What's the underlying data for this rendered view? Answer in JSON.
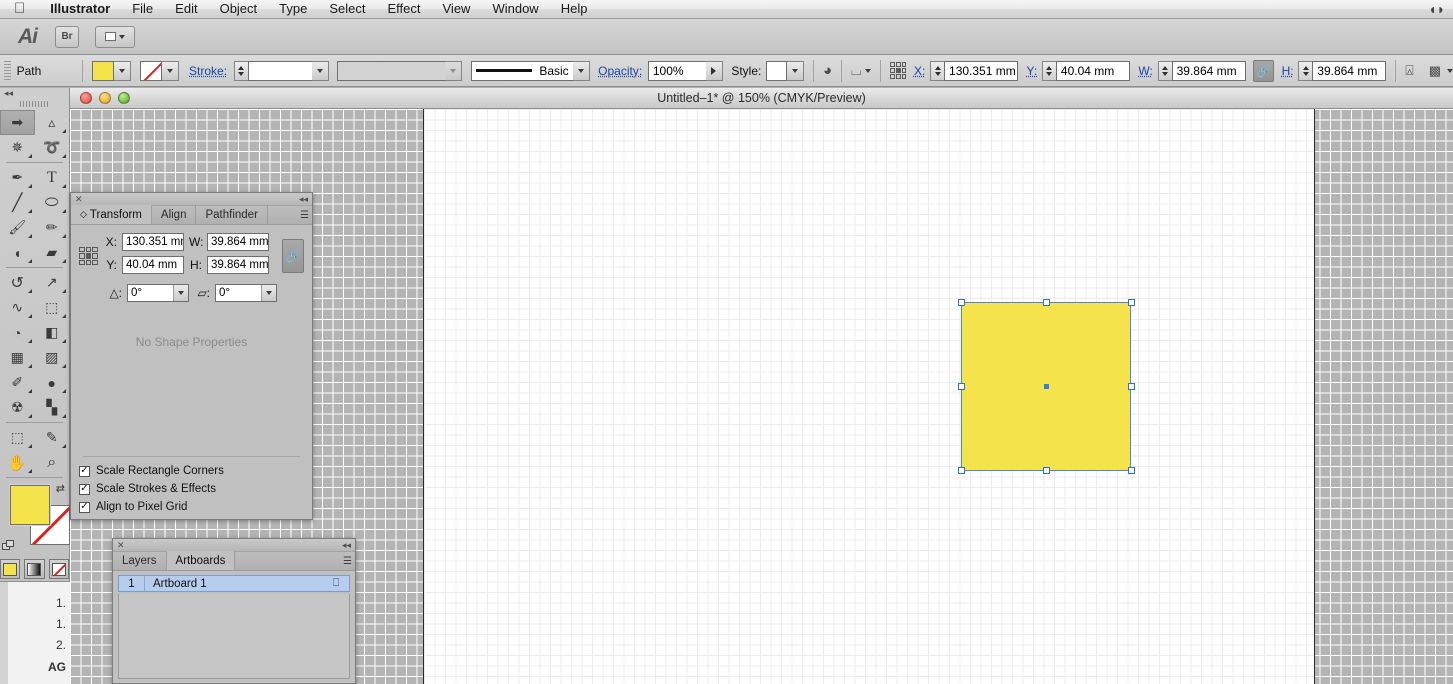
{
  "menubar": {
    "apple": "apple-logo",
    "items": [
      "Illustrator",
      "File",
      "Edit",
      "Object",
      "Type",
      "Select",
      "Effect",
      "View",
      "Window",
      "Help"
    ],
    "right_icon": "spectacles-icon"
  },
  "appbar": {
    "logo": "Ai",
    "bridge_label": "Br",
    "arrange_label": "arrange-documents"
  },
  "controlbar": {
    "selection_label": "Path",
    "fill_color": "#f4e34a",
    "stroke_label": "Stroke:",
    "stroke_weight": "",
    "stroke_profile": "",
    "brush_label": "Basic",
    "opacity_label": "Opacity:",
    "opacity_value": "100%",
    "style_label": "Style:",
    "x_label": "X:",
    "x_value": "130.351 mm",
    "y_label": "Y:",
    "y_value": "40.04 mm",
    "w_label": "W:",
    "w_value": "39.864 mm",
    "h_label": "H:",
    "h_value": "39.864 mm",
    "link_icon": "link-chain-icon",
    "recolor_icon": "recolor-artwork-icon",
    "isolate_icon": "isolate-selection-icon",
    "transform_proxy_icon": "transform-reference-point-icon",
    "align_icon": "align-objects-icon",
    "select_similar_icon": "select-similar-objects-icon"
  },
  "document": {
    "title": "Untitled–1* @ 150% (CMYK/Preview)",
    "zoom": "150%",
    "color_mode": "CMYK/Preview"
  },
  "tools": {
    "items": [
      {
        "name": "selection-tool",
        "glyph": "⬉",
        "selected": true
      },
      {
        "name": "direct-selection-tool",
        "glyph": "⬈",
        "selected": false
      },
      {
        "name": "magic-wand-tool",
        "glyph": "✳",
        "selected": false
      },
      {
        "name": "lasso-tool",
        "glyph": "➰",
        "selected": false
      },
      {
        "name": "pen-tool",
        "glyph": "✒",
        "selected": false
      },
      {
        "name": "type-tool",
        "glyph": "T",
        "selected": false
      },
      {
        "name": "line-segment-tool",
        "glyph": "╱",
        "selected": false
      },
      {
        "name": "ellipse-tool",
        "glyph": "⬭",
        "selected": false
      },
      {
        "name": "paintbrush-tool",
        "glyph": "✎",
        "selected": false
      },
      {
        "name": "pencil-tool",
        "glyph": "✏",
        "selected": false
      },
      {
        "name": "blob-brush-tool",
        "glyph": "◖",
        "selected": false
      },
      {
        "name": "eraser-tool",
        "glyph": "▰",
        "selected": false
      },
      {
        "name": "rotate-tool",
        "glyph": "↺",
        "selected": false
      },
      {
        "name": "scale-tool",
        "glyph": "↗",
        "selected": false
      },
      {
        "name": "width-tool",
        "glyph": "∿",
        "selected": false
      },
      {
        "name": "free-transform-tool",
        "glyph": "⬚",
        "selected": false
      },
      {
        "name": "shape-builder-tool",
        "glyph": "◔",
        "selected": false
      },
      {
        "name": "perspective-grid-tool",
        "glyph": "◧",
        "selected": false
      },
      {
        "name": "mesh-tool",
        "glyph": "✦",
        "selected": false
      },
      {
        "name": "gradient-tool",
        "glyph": "▨",
        "selected": false
      },
      {
        "name": "eyedropper-tool",
        "glyph": "✐",
        "selected": false
      },
      {
        "name": "blend-tool",
        "glyph": "●",
        "selected": false
      },
      {
        "name": "symbol-sprayer-tool",
        "glyph": "☃",
        "selected": false
      },
      {
        "name": "column-graph-tool",
        "glyph": "▐",
        "selected": false
      },
      {
        "name": "artboard-tool",
        "glyph": "⬚",
        "selected": false
      },
      {
        "name": "slice-tool",
        "glyph": "✂",
        "selected": false
      },
      {
        "name": "hand-tool",
        "glyph": "✋",
        "selected": false
      },
      {
        "name": "zoom-tool",
        "glyph": "⌕",
        "selected": false
      }
    ],
    "fill_color": "#f4e34a",
    "stroke_color": "none",
    "swap_icon": "swap-fill-stroke-icon",
    "default_icon": "default-fill-stroke-icon",
    "modes": [
      "color-mode",
      "gradient-mode",
      "none-mode"
    ],
    "draw_modes": [
      "draw-normal",
      "draw-behind",
      "draw-inside"
    ],
    "screen_mode": "change-screen-mode"
  },
  "transform_panel": {
    "close_icon": "close-icon",
    "collapse_icon": "collapse-to-icons-icon",
    "menu_icon": "panel-menu-icon",
    "tabs": [
      {
        "label": "Transform",
        "active": true
      },
      {
        "label": "Align",
        "active": false
      },
      {
        "label": "Pathfinder",
        "active": false
      }
    ],
    "reference_point_icon": "reference-point-grid-icon",
    "x_label": "X:",
    "x_value": "130.351 mm",
    "y_label": "Y:",
    "y_value": "40.04 mm",
    "w_label": "W:",
    "w_value": "39.864 mm",
    "h_label": "H:",
    "h_value": "39.864 mm",
    "constrain_icon": "constrain-proportions-icon",
    "rotate_label": "△:",
    "rotate_value": "0°",
    "shear_label": "▱:",
    "shear_value": "0°",
    "no_shape_text": "No Shape Properties",
    "checkboxes": [
      {
        "label": "Scale Rectangle Corners",
        "checked": true
      },
      {
        "label": "Scale Strokes & Effects",
        "checked": true
      },
      {
        "label": "Align to Pixel Grid",
        "checked": true
      }
    ]
  },
  "layers_panel": {
    "close_icon": "close-icon",
    "collapse_icon": "collapse-to-icons-icon",
    "menu_icon": "panel-menu-icon",
    "tabs": [
      {
        "label": "Layers",
        "active": false
      },
      {
        "label": "Artboards",
        "active": true
      }
    ],
    "rows": [
      {
        "number": "1",
        "name": "Artboard 1",
        "icon": "artboard-options-icon"
      }
    ]
  },
  "artwork": {
    "shape_name": "yellow-rectangle",
    "fill": "#f4e34a",
    "selection_color": "#4a86e8",
    "handles": [
      "tl",
      "tc",
      "tr",
      "ml",
      "mr",
      "bl",
      "bc",
      "br"
    ],
    "center_point": "anchor-center-point"
  },
  "background_document": {
    "lines": [
      "1.",
      "1.",
      "2.",
      "AG"
    ]
  }
}
